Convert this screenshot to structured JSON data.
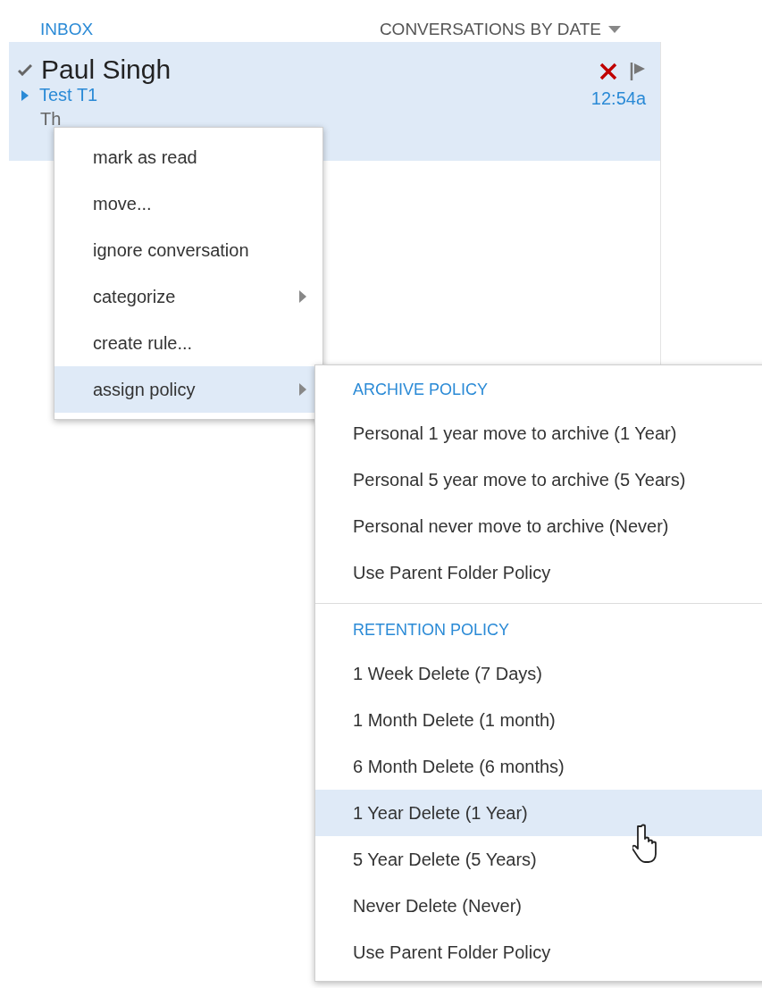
{
  "header": {
    "folder": "INBOX",
    "sort": "CONVERSATIONS BY DATE"
  },
  "messages": [
    {
      "sender": "Paul Singh",
      "subject": "Test T1",
      "preview": "Th",
      "time": "12:54a",
      "selected": true
    }
  ],
  "context_menu": {
    "items": [
      {
        "label": "mark as read",
        "has_submenu": false,
        "selected": false
      },
      {
        "label": "move...",
        "has_submenu": false,
        "selected": false
      },
      {
        "label": "ignore conversation",
        "has_submenu": false,
        "selected": false
      },
      {
        "label": "categorize",
        "has_submenu": true,
        "selected": false
      },
      {
        "label": "create rule...",
        "has_submenu": false,
        "selected": false
      },
      {
        "label": "assign policy",
        "has_submenu": true,
        "selected": true
      }
    ]
  },
  "submenu": {
    "sections": [
      {
        "heading": "ARCHIVE POLICY",
        "items": [
          {
            "label": "Personal 1 year move to archive (1 Year)",
            "selected": false
          },
          {
            "label": "Personal 5 year move to archive (5 Years)",
            "selected": false
          },
          {
            "label": "Personal never move to archive (Never)",
            "selected": false
          },
          {
            "label": "Use Parent Folder Policy",
            "selected": false
          }
        ]
      },
      {
        "heading": "RETENTION POLICY",
        "items": [
          {
            "label": "1 Week Delete (7 Days)",
            "selected": false
          },
          {
            "label": "1 Month Delete (1 month)",
            "selected": false
          },
          {
            "label": "6 Month Delete (6 months)",
            "selected": false
          },
          {
            "label": "1 Year Delete (1 Year)",
            "selected": true
          },
          {
            "label": "5 Year Delete (5 Years)",
            "selected": false
          },
          {
            "label": "Never Delete (Never)",
            "selected": false
          },
          {
            "label": "Use Parent Folder Policy",
            "selected": false
          }
        ]
      }
    ]
  }
}
